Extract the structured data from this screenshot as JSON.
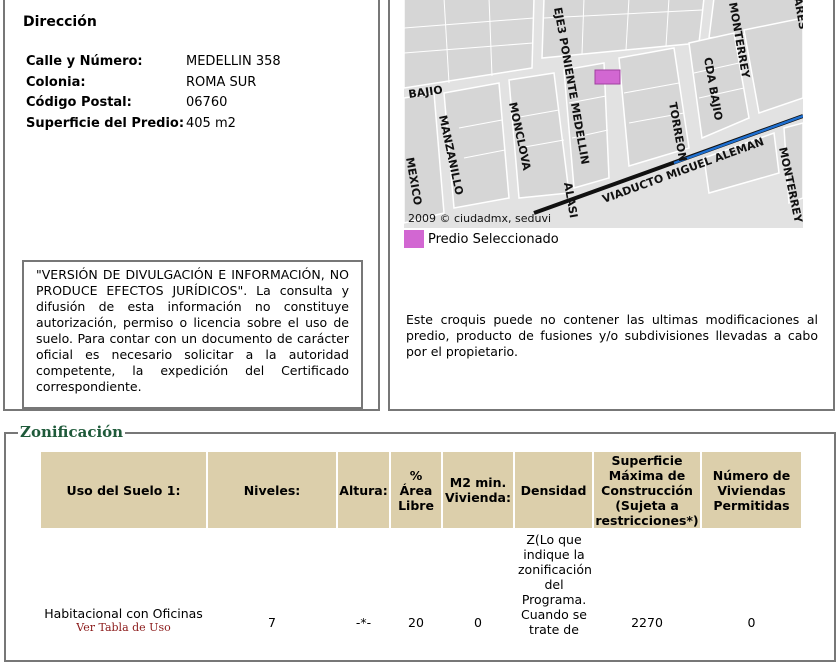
{
  "direccion": {
    "title": "Dirección",
    "fields": [
      {
        "label": "Calle y Número:",
        "value": "MEDELLIN 358"
      },
      {
        "label": "Colonia:",
        "value": "ROMA SUR"
      },
      {
        "label": "Código Postal:",
        "value": "06760"
      },
      {
        "label": "Superficie del Predio:",
        "value": "405 m2"
      }
    ],
    "disclaimer": "\"VERSIÓN DE DIVULGACIÓN E INFORMACIÓN, NO PRODUCE EFECTOS JURÍDICOS\". La consulta y difusión de esta información no constituye autorización, permiso o licencia sobre el uso de suelo. Para contar con un documento de carácter oficial es necesario solicitar a la autoridad competente, la expedición del Certificado correspondiente."
  },
  "map": {
    "copyright": "2009 © ciudadmx, seduvi",
    "legend_label": "Predio Seleccionado",
    "legend_color": "#d267d2",
    "street_labels": [
      "BAJIO",
      "EJE3 PONIENTE MEDELLIN",
      "MONTERREY",
      "CDA BAJIO",
      "TORREON",
      "MONCLOVA",
      "MANZANILLO",
      "VIADUCTO MIGUEL ALEMAN",
      "MONTERREY",
      "MEXICO",
      "ALASI",
      "ARES"
    ],
    "note": "Este croquis puede no contener las ultimas modificaciones al predio, producto de fusiones y/o subdivisiones llevadas a cabo por el propietario."
  },
  "zonificacion": {
    "title": "Zonificación",
    "headers": [
      "Uso del Suelo 1:",
      "Niveles:",
      "Altura:",
      "% Área Libre",
      "M2 min. Vivienda:",
      "Densidad",
      "Superficie Máxima de Construcción (Sujeta a restricciones*)",
      "Número de Viviendas Permitidas"
    ],
    "row": {
      "uso": "Habitacional con Oficinas",
      "uso_link": "Ver Tabla de Uso",
      "niveles": "7",
      "altura": "-*-",
      "area_libre": "20",
      "m2_min": "0",
      "densidad": "Z(Lo que indique la zonificación del Programa. Cuando se trate de",
      "superficie": "2270",
      "viviendas": "0"
    },
    "header_color": "#dccfab",
    "title_color": "#1f5a3a",
    "link_color": "#8b1a1a"
  }
}
